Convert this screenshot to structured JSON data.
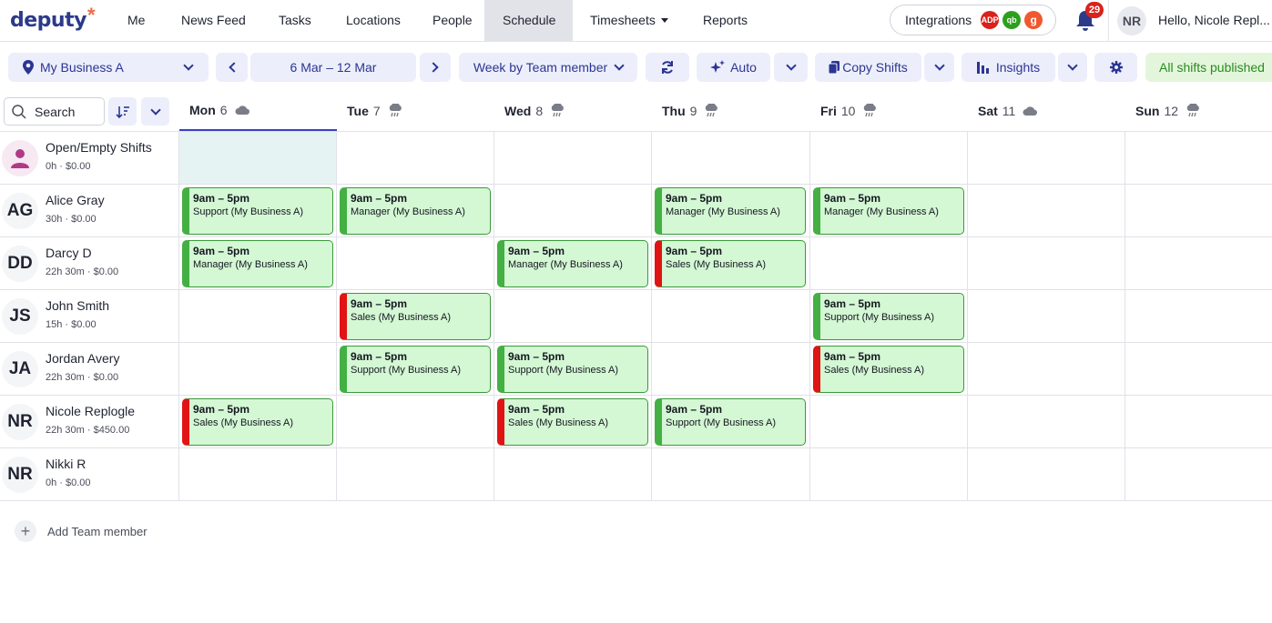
{
  "app": {
    "logo_text": "deputy",
    "logo_mark": "*"
  },
  "nav": {
    "items": [
      "Me",
      "News Feed",
      "Tasks",
      "Locations",
      "People",
      "Schedule",
      "Timesheets",
      "Reports"
    ],
    "active": "Schedule",
    "integrations_label": "Integrations",
    "integration_badges": [
      "ADP",
      "qb",
      "g"
    ],
    "notifications_count": "29",
    "user_initials": "NR",
    "greeting": "Hello, Nicole Repl..."
  },
  "toolbar": {
    "location": "My Business A",
    "date_range": "6 Mar – 12 Mar",
    "view": "Week by Team member",
    "auto_label": "Auto",
    "copy_shifts_label": "Copy Shifts",
    "insights_label": "Insights",
    "status_label": "All shifts published"
  },
  "grid": {
    "search_placeholder": "Search",
    "days": [
      {
        "name": "Mon",
        "date": "6",
        "weather": "cloud"
      },
      {
        "name": "Tue",
        "date": "7",
        "weather": "rain"
      },
      {
        "name": "Wed",
        "date": "8",
        "weather": "rain"
      },
      {
        "name": "Thu",
        "date": "9",
        "weather": "rain"
      },
      {
        "name": "Fri",
        "date": "10",
        "weather": "rain"
      },
      {
        "name": "Sat",
        "date": "11",
        "weather": "cloud"
      },
      {
        "name": "Sun",
        "date": "12",
        "weather": "rain"
      }
    ],
    "active_day": "Mon",
    "rows": [
      {
        "initials": "",
        "name": "Open/Empty Shifts",
        "summary": "0h · $0.00",
        "icon": "person-icon"
      },
      {
        "initials": "AG",
        "name": "Alice Gray",
        "summary": "30h · $0.00"
      },
      {
        "initials": "DD",
        "name": "Darcy D",
        "summary": "22h 30m · $0.00"
      },
      {
        "initials": "JS",
        "name": "John Smith",
        "summary": "15h · $0.00"
      },
      {
        "initials": "JA",
        "name": "Jordan Avery",
        "summary": "22h 30m · $0.00"
      },
      {
        "initials": "NR",
        "name": "Nicole Replogle",
        "summary": "22h 30m · $450.00"
      },
      {
        "initials": "NR",
        "name": "Nikki R",
        "summary": "0h · $0.00"
      }
    ],
    "shifts": [
      {
        "row": 1,
        "day": 0,
        "time": "9am – 5pm",
        "role": "Support (My Business A)",
        "status": "green"
      },
      {
        "row": 1,
        "day": 1,
        "time": "9am – 5pm",
        "role": "Manager (My Business A)",
        "status": "green"
      },
      {
        "row": 1,
        "day": 3,
        "time": "9am – 5pm",
        "role": "Manager (My Business A)",
        "status": "green"
      },
      {
        "row": 1,
        "day": 4,
        "time": "9am – 5pm",
        "role": "Manager (My Business A)",
        "status": "green"
      },
      {
        "row": 2,
        "day": 0,
        "time": "9am – 5pm",
        "role": "Manager (My Business A)",
        "status": "green"
      },
      {
        "row": 2,
        "day": 2,
        "time": "9am – 5pm",
        "role": "Manager (My Business A)",
        "status": "green"
      },
      {
        "row": 2,
        "day": 3,
        "time": "9am – 5pm",
        "role": "Sales (My Business A)",
        "status": "red"
      },
      {
        "row": 3,
        "day": 1,
        "time": "9am – 5pm",
        "role": "Sales (My Business A)",
        "status": "red"
      },
      {
        "row": 3,
        "day": 4,
        "time": "9am – 5pm",
        "role": "Support (My Business A)",
        "status": "green"
      },
      {
        "row": 4,
        "day": 1,
        "time": "9am – 5pm",
        "role": "Support (My Business A)",
        "status": "green"
      },
      {
        "row": 4,
        "day": 2,
        "time": "9am – 5pm",
        "role": "Support (My Business A)",
        "status": "green"
      },
      {
        "row": 4,
        "day": 4,
        "time": "9am – 5pm",
        "role": "Sales (My Business A)",
        "status": "red"
      },
      {
        "row": 5,
        "day": 0,
        "time": "9am – 5pm",
        "role": "Sales (My Business A)",
        "status": "red"
      },
      {
        "row": 5,
        "day": 2,
        "time": "9am – 5pm",
        "role": "Sales (My Business A)",
        "status": "red"
      },
      {
        "row": 5,
        "day": 3,
        "time": "9am – 5pm",
        "role": "Support (My Business A)",
        "status": "green"
      }
    ],
    "add_member_label": "Add Team member"
  },
  "colors": {
    "brand": "#2c3a8a",
    "accent": "#2c3592",
    "shift_bg": "#d4f7d4",
    "shift_ok": "#44b044",
    "shift_warn": "#e01414",
    "published": "#2b8a1f"
  }
}
